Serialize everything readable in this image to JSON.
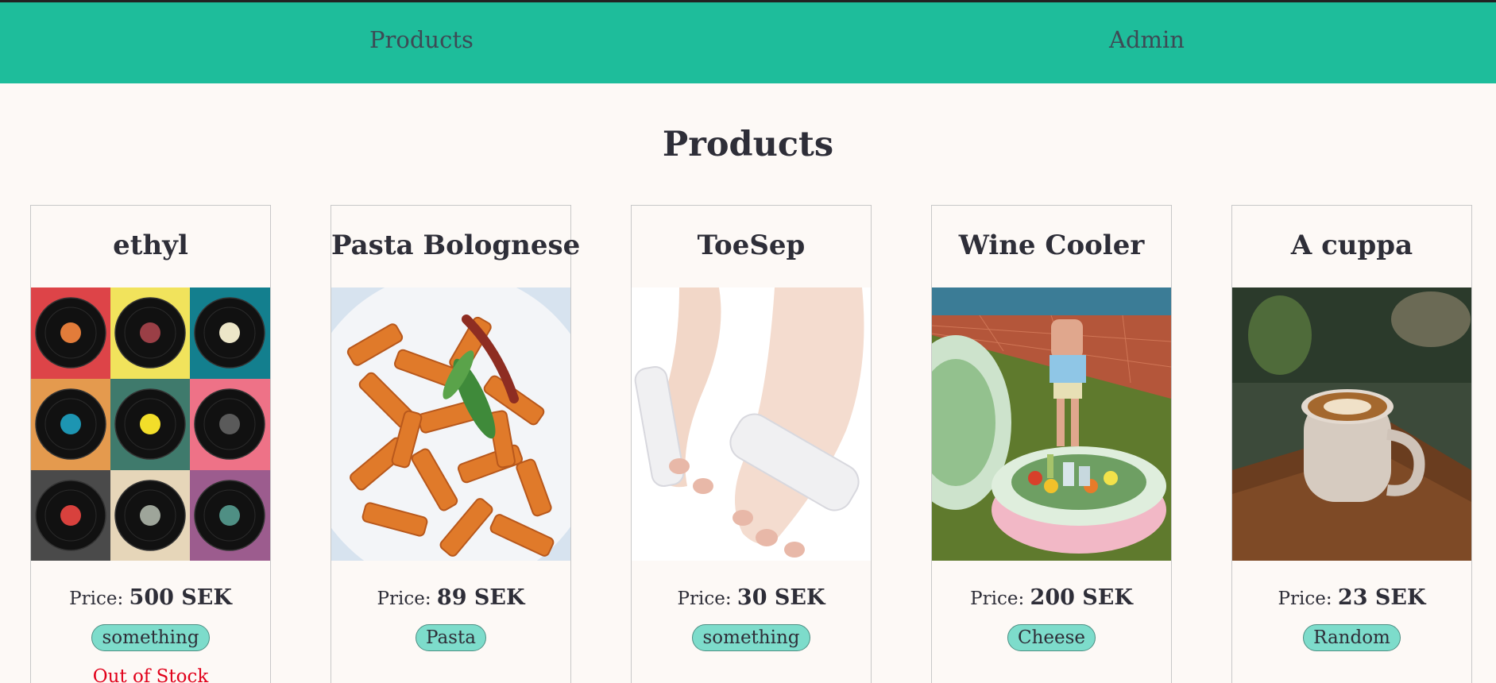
{
  "nav": {
    "products_label": "Products",
    "admin_label": "Admin"
  },
  "page": {
    "title": "Products"
  },
  "price_prefix": "Price:",
  "products": [
    {
      "name": "ethyl",
      "price": "500 SEK",
      "tag": "something",
      "stock": "Out of Stock"
    },
    {
      "name": "Pasta Bolognese",
      "price": "89 SEK",
      "tag": "Pasta"
    },
    {
      "name": "ToeSep",
      "price": "30 SEK",
      "tag": "something"
    },
    {
      "name": "Wine Cooler",
      "price": "200 SEK",
      "tag": "Cheese"
    },
    {
      "name": "A cuppa",
      "price": "23 SEK",
      "tag": "Random"
    }
  ],
  "colors": {
    "nav_bar": "#1ebd9b",
    "tag_bg": "#7ddccb",
    "out_of_stock": "#e1001a"
  }
}
